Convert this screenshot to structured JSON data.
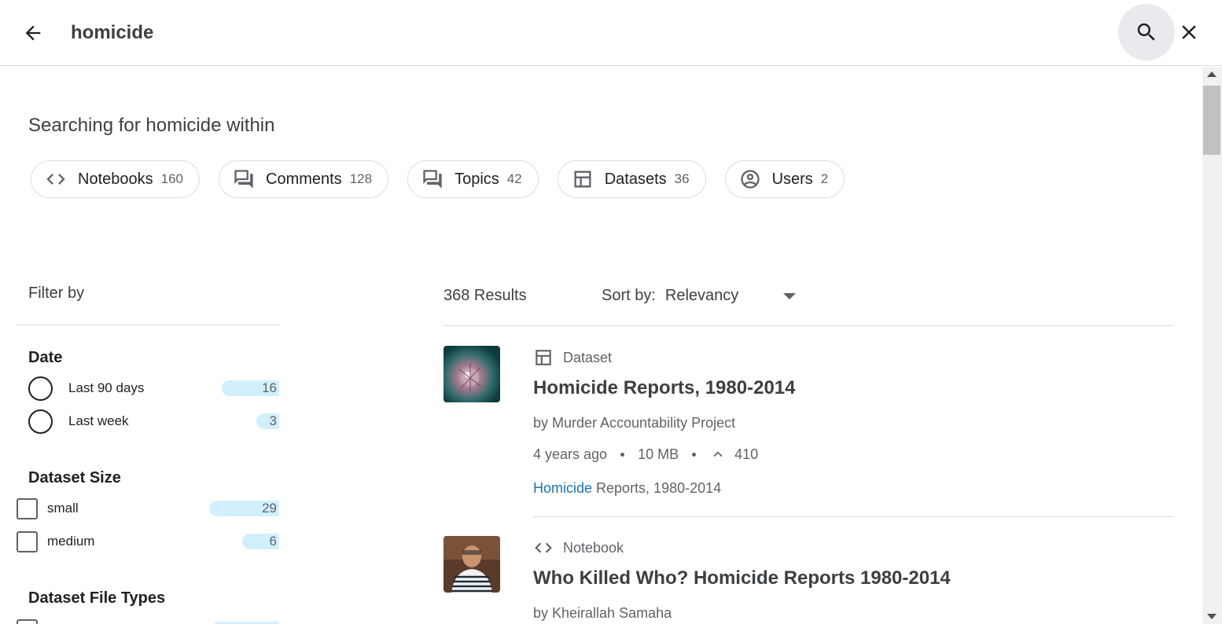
{
  "search": {
    "query": "homicide",
    "placeholder": "Search"
  },
  "heading": {
    "prefix": "Searching for homicide within"
  },
  "categories": [
    {
      "label": "Notebooks",
      "count": "160",
      "icon": "code-icon"
    },
    {
      "label": "Comments",
      "count": "128",
      "icon": "comments-icon"
    },
    {
      "label": "Topics",
      "count": "42",
      "icon": "topics-icon"
    },
    {
      "label": "Datasets",
      "count": "36",
      "icon": "table-icon"
    },
    {
      "label": "Users",
      "count": "2",
      "icon": "user-circle-icon"
    }
  ],
  "filters": {
    "title": "Filter by",
    "date": {
      "title": "Date",
      "options": [
        {
          "label": "Last 90 days",
          "count": "16",
          "fraction": 0.22
        },
        {
          "label": "Last week",
          "count": "3",
          "fraction": 0.09
        }
      ]
    },
    "size": {
      "title": "Dataset Size",
      "options": [
        {
          "label": "small",
          "count": "29",
          "fraction": 0.27
        },
        {
          "label": "medium",
          "count": "6",
          "fraction": 0.14
        }
      ]
    },
    "file_types": {
      "title": "Dataset File Types"
    }
  },
  "results": {
    "count_label": "368 Results",
    "sort_label": "Sort by:",
    "sort_value": "Relevancy",
    "items": [
      {
        "type": "Dataset",
        "type_icon": "table-icon",
        "title": "Homicide Reports, 1980-2014",
        "author": "by Murder Accountability Project",
        "age": "4 years ago",
        "size": "10 MB",
        "votes": "410",
        "snippet_highlight": "Homicide",
        "snippet_rest": " Reports, 1980-2014"
      },
      {
        "type": "Notebook",
        "type_icon": "code-icon",
        "title": "Who Killed Who? Homicide Reports 1980-2014",
        "author": "by Kheirallah Samaha"
      }
    ]
  },
  "colors": {
    "accent": "#1a73b8",
    "count_bar": "#d2effd",
    "search_button_bg": "#e8eaed"
  }
}
